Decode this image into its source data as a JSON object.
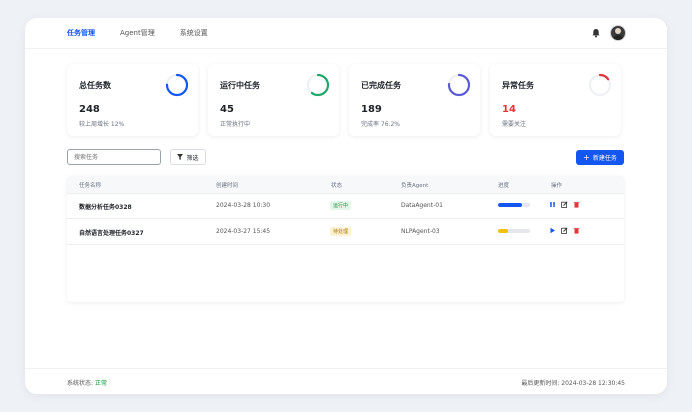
{
  "nav": {
    "items": [
      {
        "label": "任务管理",
        "active": true
      },
      {
        "label": "Agent管理",
        "active": false
      },
      {
        "label": "系统设置",
        "active": false
      }
    ]
  },
  "stats": [
    {
      "title": "总任务数",
      "value": "248",
      "sub": "较上周增长 12%",
      "value_color": "#1f2329",
      "ring_color": "#1456f0",
      "ring_fraction": 0.75
    },
    {
      "title": "运行中任务",
      "value": "45",
      "sub": "正常执行中",
      "value_color": "#1f2329",
      "ring_color": "#1fa86a",
      "ring_fraction": 0.6
    },
    {
      "title": "已完成任务",
      "value": "189",
      "sub": "完成率 76.2%",
      "value_color": "#1f2329",
      "ring_color": "#5b5bd6",
      "ring_fraction": 0.762
    },
    {
      "title": "异常任务",
      "value": "14",
      "sub": "需要关注",
      "value_color": "#e5343a",
      "ring_color": "#e5343a",
      "ring_fraction": 0.15
    }
  ],
  "toolbar": {
    "search_placeholder": "搜索任务",
    "filter_label": "筛选",
    "new_label": "新建任务"
  },
  "table": {
    "headers": [
      "任务名称",
      "创建时间",
      "状态",
      "负责Agent",
      "进度",
      "操作"
    ],
    "rows": [
      {
        "name": "数据分析任务0328",
        "created": "2024-03-28 10:30",
        "status": "运行中",
        "status_type": "run",
        "agent": "DataAgent-01",
        "progress": 0.75,
        "progress_color": "#1456f0",
        "action_icon": "pause-icon"
      },
      {
        "name": "自然语言处理任务0327",
        "created": "2024-03-27 15:45",
        "status": "待处理",
        "status_type": "wait",
        "agent": "NLPAgent-03",
        "progress": 0.3,
        "progress_color": "#f2c200",
        "action_icon": "play-icon"
      }
    ]
  },
  "footer": {
    "status_label": "系统状态:",
    "status_value": "正常",
    "updated": "最后更新时间: 2024-03-28 12:30:45"
  },
  "colors": {
    "accent": "#1456f0",
    "danger": "#e5343a",
    "success": "#1b8f3a"
  }
}
